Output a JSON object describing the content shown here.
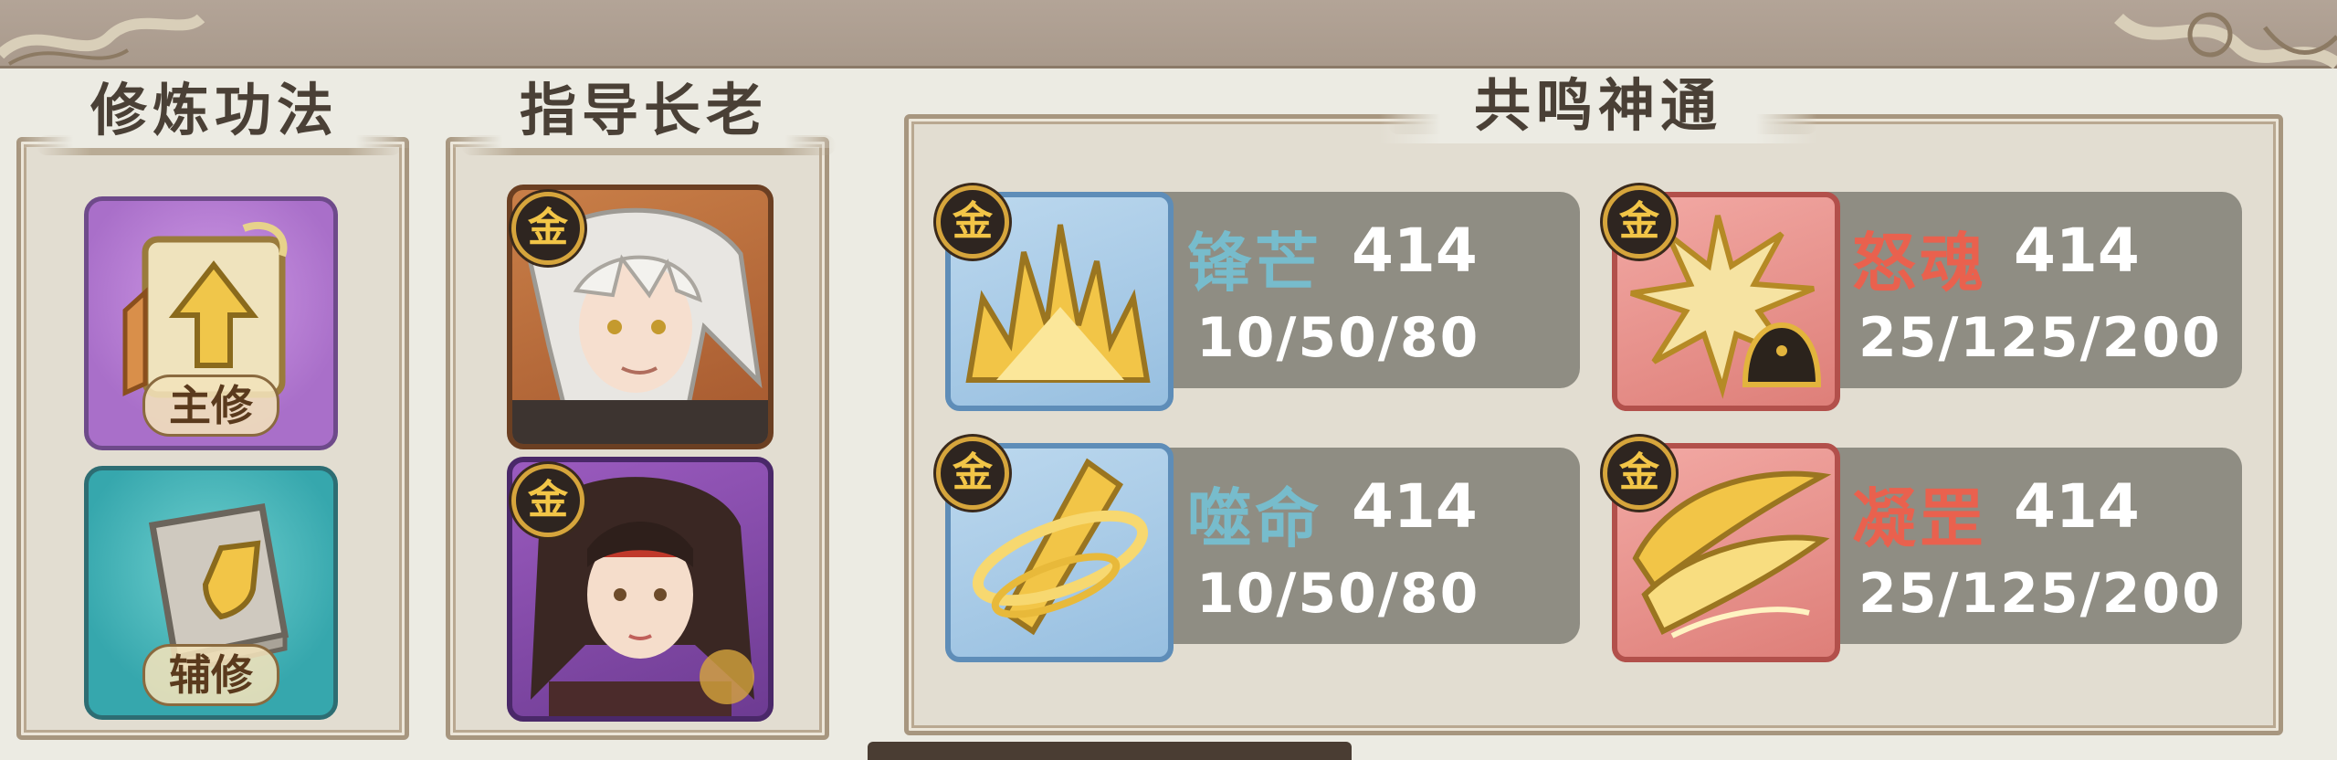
{
  "sections": {
    "cultivation": {
      "title": "修炼功法",
      "main_label": "主修",
      "aux_label": "辅修"
    },
    "elders": {
      "title": "指导长老"
    },
    "resonance": {
      "title": "共鸣神通"
    }
  },
  "grade_badge": "金",
  "skills": [
    {
      "name": "锋芒",
      "level": "414",
      "values": "10/50/80",
      "rarity_color": "#77bccc",
      "icon": "flame-spikes-icon"
    },
    {
      "name": "怒魂",
      "level": "414",
      "values": "25/125/200",
      "rarity_color": "#e9614e",
      "icon": "burst-spirit-icon"
    },
    {
      "name": "噬命",
      "level": "414",
      "values": "10/50/80",
      "rarity_color": "#77bccc",
      "icon": "spiral-blade-icon"
    },
    {
      "name": "凝罡",
      "level": "414",
      "values": "25/125/200",
      "rarity_color": "#e9614e",
      "icon": "gold-wings-icon"
    }
  ],
  "colors": {
    "background": "#ecebe3",
    "gold": "#f2c547",
    "skill_row_bg": "#8f8d83"
  }
}
